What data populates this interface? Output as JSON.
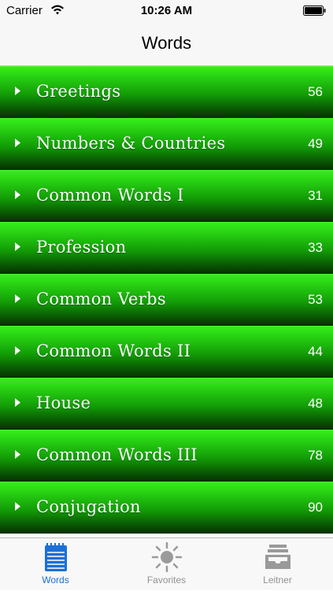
{
  "status_bar": {
    "carrier": "Carrier",
    "time": "10:26 AM"
  },
  "nav": {
    "title": "Words"
  },
  "categories": [
    {
      "label": "Greetings",
      "count": "56"
    },
    {
      "label": "Numbers & Countries",
      "count": "49"
    },
    {
      "label": "Common Words I",
      "count": "31"
    },
    {
      "label": "Profession",
      "count": "33"
    },
    {
      "label": "Common Verbs",
      "count": "53"
    },
    {
      "label": "Common Words II",
      "count": "44"
    },
    {
      "label": "House",
      "count": "48"
    },
    {
      "label": "Common Words III",
      "count": "78"
    },
    {
      "label": "Conjugation",
      "count": "90"
    }
  ],
  "tabs": [
    {
      "label": "Words",
      "icon": "notepad-icon",
      "active": true
    },
    {
      "label": "Favorites",
      "icon": "sun-icon",
      "active": false
    },
    {
      "label": "Leitner",
      "icon": "inbox-tray-icon",
      "active": false
    }
  ],
  "colors": {
    "row_gradient_top": "#35ee1a",
    "row_gradient_bottom": "#062f02",
    "tab_active": "#1d6fd8",
    "tab_inactive": "#929292"
  }
}
